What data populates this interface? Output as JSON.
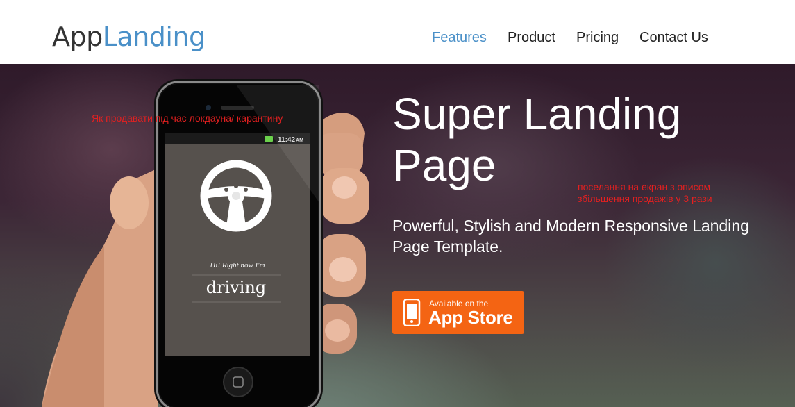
{
  "brand": {
    "part1": "App",
    "part2": "Landing"
  },
  "nav": [
    {
      "label": "Features",
      "active": true
    },
    {
      "label": "Product",
      "active": false
    },
    {
      "label": "Pricing",
      "active": false
    },
    {
      "label": "Contact Us",
      "active": false
    }
  ],
  "hero": {
    "title": "Super Landing Page",
    "subtitle": "Powerful, Stylish and Modern Responsive Landing Page Template.",
    "appstore": {
      "small": "Available on the",
      "big": "App Store",
      "icon": "phone-icon"
    }
  },
  "phone_screen": {
    "time": "11:42",
    "ampm": "AM",
    "status_line": "Hi! Right now I'm",
    "status_word": "driving",
    "icon": "steering-wheel-icon"
  },
  "annotations": {
    "note1": "Як продавати під час локдауна/ карантину",
    "note2": "поселання на екран з описом збільшення продажів у 3 рази"
  },
  "colors": {
    "accent": "#4a90c8",
    "button": "#f46413",
    "note": "#e42020"
  }
}
